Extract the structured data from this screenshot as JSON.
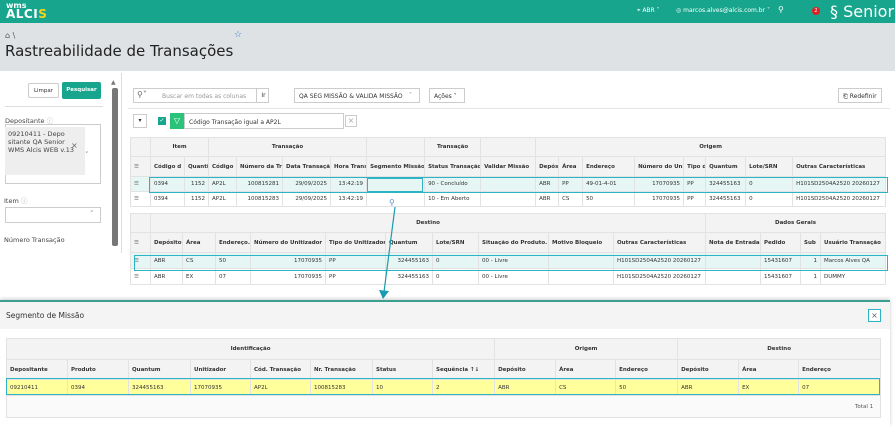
{
  "app": {
    "logo_top": "wms",
    "logo_main": "ALCI",
    "logo_accent": "S",
    "brand": "Senior",
    "location": "ABR",
    "user": "marcos.alves@alcis.com.br",
    "notifications": "2"
  },
  "page": {
    "title": "Rastreabilidade de Transações",
    "breadcrumb": "\\"
  },
  "filters": {
    "clear": "Limpar",
    "search": "Pesquisar",
    "depositante_label": "Depositante",
    "depositante_value": "09210411 - Depo sitante QA Senior WMS Alcis WEB v.13",
    "item_label": "Item",
    "numero_label": "Número Transação"
  },
  "toolbar": {
    "search_placeholder": "Buscar em todas as colunas",
    "go": "Ir",
    "report": "QA SEG MISSÃO & VALIDA MISSÃO",
    "actions": "Ações",
    "reset": "Redefinir",
    "filter_text": "Código Transação igual a AP2L"
  },
  "grid1": {
    "groups": [
      {
        "label": "",
        "span": 1
      },
      {
        "label": "Item",
        "span": 2
      },
      {
        "label": "Transação",
        "span": 4
      },
      {
        "label": "",
        "span": 1
      },
      {
        "label": "Transação",
        "span": 1
      },
      {
        "label": "",
        "span": 1
      },
      {
        "label": "Origem",
        "span": 8
      }
    ],
    "columns": [
      "",
      "Código d",
      "Quanti",
      "Código",
      "Número da Tr",
      "Data Transação",
      "Hora Trans",
      "Segmento Missão.",
      "Status Transação..",
      "Validar Missão",
      "Depósi",
      "Área",
      "Endereço",
      "Número do Uni",
      "Tipo d",
      "Quantum",
      "Lote/SRN",
      "Outras Características"
    ],
    "rows": [
      [
        "",
        "0394",
        "1152",
        "AP2L",
        "100815281",
        "29/09/2025",
        "13:42:19",
        "",
        "90 - Concluído",
        "",
        "ABR",
        "PP",
        "49-01-4-01",
        "17070935",
        "PP",
        "324455163",
        "0",
        "H101SD2504A2520 20260127"
      ],
      [
        "",
        "0394",
        "1152",
        "AP2L",
        "100815283",
        "29/09/2025",
        "13:42:19",
        "",
        "10 - Em Aberto",
        "",
        "ABR",
        "CS",
        "50",
        "17070935",
        "PP",
        "324455163",
        "0",
        "H101SD2504A2520 20260127"
      ]
    ]
  },
  "grid2": {
    "groups": [
      {
        "label": "",
        "span": 1
      },
      {
        "label": "Destino",
        "span": 10
      },
      {
        "label": "Dados Gerais",
        "span": 4
      }
    ],
    "columns": [
      "",
      "Depósito.",
      "Área",
      "Endereço..",
      "Número do Unitizador",
      "Tipo do Unitizador",
      "Quantum",
      "Lote/SRN",
      "Situação do Produto.",
      "Motivo Bloqueio",
      "Outras Características",
      "Nota de Entrada..",
      "Pedido",
      "Sub",
      "Usuário Transação"
    ],
    "rows": [
      [
        "",
        "ABR",
        "CS",
        "50",
        "17070935",
        "PP",
        "324455163",
        "0",
        "00 - Livre",
        "",
        "H101SD2504A2520 20260127",
        "",
        "15431607",
        "1",
        "Marcos Alves QA"
      ],
      [
        "",
        "ABR",
        "EX",
        "07",
        "17070935",
        "PP",
        "324455163",
        "0",
        "00 - Livre",
        "",
        "H101SD2504A2520 20260127",
        "",
        "15431607",
        "1",
        "DUMMY"
      ]
    ]
  },
  "modal": {
    "title": "Segmento de Missão",
    "total": "Total 1",
    "groups": [
      {
        "label": "Identificação",
        "span": 8
      },
      {
        "label": "Origem",
        "span": 3
      },
      {
        "label": "Destino",
        "span": 3
      }
    ],
    "columns": [
      "Depositante",
      "Produto",
      "Quantum",
      "Unitizador",
      "Cód. Transação",
      "Nr. Transação",
      "Status",
      "Sequência ↑↓",
      "Depósito",
      "Área",
      "Endereço",
      "Depósito",
      "Área",
      "Endereço"
    ],
    "rows": [
      [
        "09210411",
        "0394",
        "324455163",
        "17070935",
        "AP2L",
        "100815283",
        "10",
        "2",
        "ABR",
        "CS",
        "50",
        "ABR",
        "EX",
        "07"
      ]
    ],
    "highlight_color": "#ffff9c"
  },
  "colors": {
    "brand": "#17a68d",
    "highlight": "#2cb3c4"
  }
}
